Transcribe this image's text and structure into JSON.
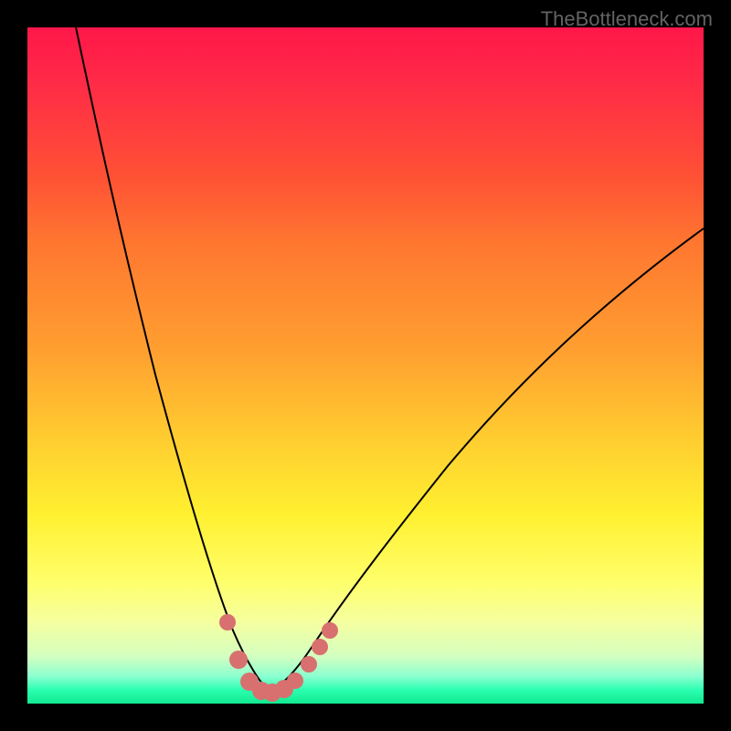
{
  "watermark": "TheBottleneck.com",
  "chart_data": {
    "type": "line",
    "title": "",
    "xlabel": "",
    "ylabel": "",
    "xlim": [
      0,
      100
    ],
    "ylim": [
      0,
      100
    ],
    "series": [
      {
        "name": "bottleneck-curve",
        "x": [
          7,
          10,
          15,
          20,
          25,
          28,
          30,
          32,
          34,
          35,
          36,
          38,
          40,
          45,
          50,
          55,
          60,
          65,
          70,
          75,
          80,
          85,
          90,
          95,
          100
        ],
        "y": [
          100,
          90,
          72,
          54,
          36,
          24,
          16,
          8,
          3,
          1,
          0.5,
          1,
          3,
          10,
          18,
          25,
          32,
          39,
          45,
          51,
          56,
          61,
          65,
          69,
          73
        ]
      }
    ],
    "markers": {
      "name": "highlighted-points",
      "x": [
        29.5,
        31,
        32.5,
        34,
        35.5,
        37,
        38,
        40,
        41.5,
        43
      ],
      "y": [
        12,
        6,
        2,
        1,
        0.8,
        1,
        2,
        5,
        8.5,
        12
      ]
    },
    "minimum_point": {
      "x": 35.5,
      "y": 0.5
    }
  },
  "colors": {
    "gradient_top": "#ff1749",
    "gradient_mid": "#ffe030",
    "gradient_bottom": "#12e990",
    "curve": "#000000",
    "marker": "#d87070",
    "watermark": "#636363"
  }
}
